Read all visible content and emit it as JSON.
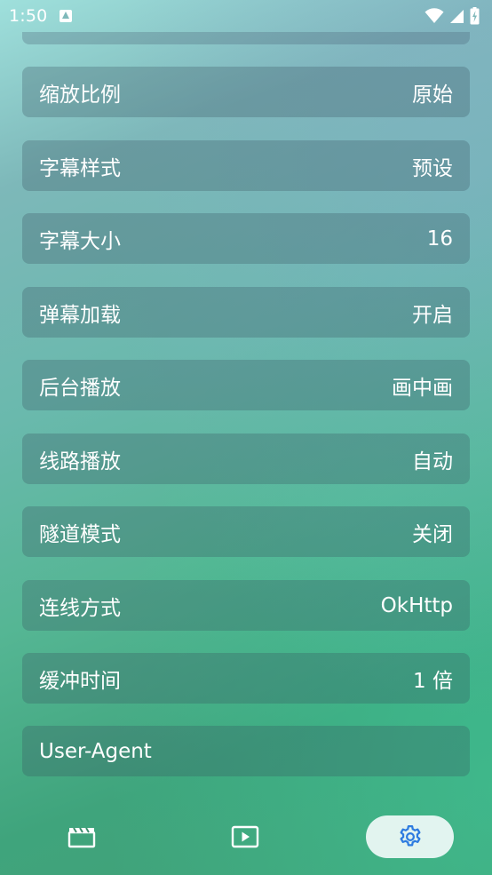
{
  "status_bar": {
    "time": "1:50",
    "notification_icon": "app-notification-icon",
    "wifi_icon": "wifi-icon",
    "signal_icon": "cell-signal-icon",
    "battery_icon": "battery-charging-icon"
  },
  "settings": {
    "rows": [
      {
        "label": "缩放比例",
        "value": "原始"
      },
      {
        "label": "字幕样式",
        "value": "预设"
      },
      {
        "label": "字幕大小",
        "value": "16"
      },
      {
        "label": "弹幕加载",
        "value": "开启"
      },
      {
        "label": "后台播放",
        "value": "画中画"
      },
      {
        "label": "线路播放",
        "value": "自动"
      },
      {
        "label": "隧道模式",
        "value": "关闭"
      },
      {
        "label": "连线方式",
        "value": "OkHttp"
      },
      {
        "label": "缓冲时间",
        "value": "1 倍"
      },
      {
        "label": "User-Agent",
        "value": ""
      }
    ]
  },
  "bottom_nav": {
    "items": [
      {
        "icon": "film-clapper-icon",
        "active": false
      },
      {
        "icon": "play-screen-icon",
        "active": false
      },
      {
        "icon": "gear-icon",
        "active": true
      }
    ],
    "active_color": "#2d7be0",
    "icon_color": "#ffffff"
  }
}
